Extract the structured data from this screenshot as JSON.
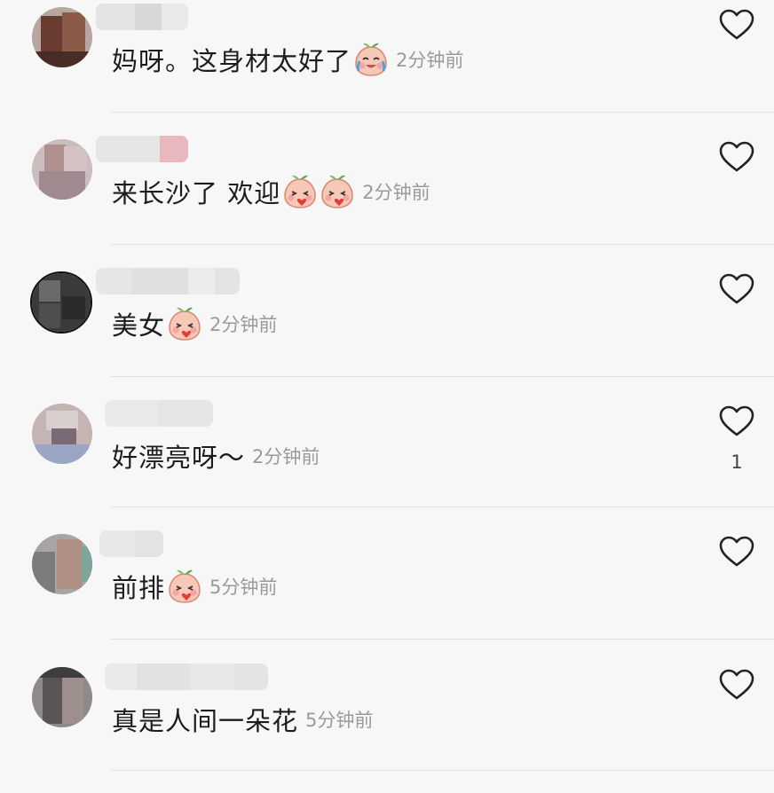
{
  "comments": [
    {
      "text": "妈呀。这身材太好了",
      "emoji": "laugh-cry-emoji",
      "time": "2分钟前",
      "like_count": ""
    },
    {
      "text": "来长沙了 欢迎",
      "emoji": "kiss-emoji",
      "time": "2分钟前",
      "like_count": ""
    },
    {
      "text": "美女",
      "emoji": "kiss-emoji",
      "time": "2分钟前",
      "like_count": ""
    },
    {
      "text": "好漂亮呀～",
      "emoji": "",
      "time": "2分钟前",
      "like_count": "1"
    },
    {
      "text": "前排",
      "emoji": "kiss-emoji",
      "time": "5分钟前",
      "like_count": ""
    },
    {
      "text": "真是人间一朵花",
      "emoji": "",
      "time": "5分钟前",
      "like_count": ""
    }
  ],
  "colors": {
    "background": "#f7f7f7",
    "comment_text": "#1c1c1c",
    "time_text": "#9a9a9a",
    "divider": "#e3e3e3",
    "heart_outline": "#222222"
  }
}
